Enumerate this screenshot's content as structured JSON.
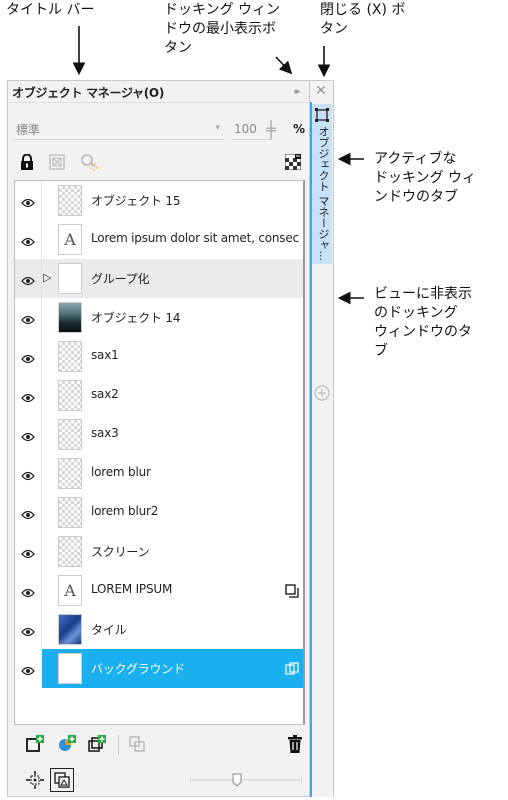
{
  "annotations": {
    "title_bar": "タイトル バー",
    "minimize": "ドッキング ウィン\nドウの最小表示ボ\nタン",
    "close": "閉じる (X) ボ\nタン",
    "active_tab": "アクティブな\nドッキング ウィ\nンドウのタブ",
    "hidden_tab": "ビューに非表示\nのドッキング\nウィンドウのタ\nブ"
  },
  "docker": {
    "title": "オブジェクト マネージャ(O)",
    "minimize_glyph": "▸▸",
    "close_glyph": "✕"
  },
  "blend": {
    "mode": "標準",
    "opacity": "100",
    "unit": "%"
  },
  "objects": [
    {
      "name": "オブジェクト 15",
      "thumb": "checker"
    },
    {
      "name": "Lorem ipsum dolor sit amet, consecte...",
      "thumb": "text",
      "glyph": "A"
    },
    {
      "name": "グループ化",
      "thumb": "white",
      "group": true,
      "expander": "▷"
    },
    {
      "name": "オブジェクト 14",
      "thumb": "photo"
    },
    {
      "name": "sax1",
      "thumb": "checker"
    },
    {
      "name": "sax2",
      "thumb": "checker"
    },
    {
      "name": "sax3",
      "thumb": "checker"
    },
    {
      "name": "lorem blur",
      "thumb": "checker"
    },
    {
      "name": "lorem blur2",
      "thumb": "checker"
    },
    {
      "name": "スクリーン",
      "thumb": "checker"
    },
    {
      "name": "LOREM IPSUM",
      "thumb": "text",
      "glyph": "A",
      "badge": "copy"
    },
    {
      "name": "タイル",
      "thumb": "tile"
    },
    {
      "name": "バックグラウンド",
      "thumb": "white",
      "selected": true,
      "badge": "link"
    }
  ],
  "tabs": {
    "active_label": "オブジェクト マネージャ...",
    "add_glyph": "+"
  },
  "colors": {
    "selection": "#1ab0ef",
    "active_tab": "#c7e2f8",
    "tab_edge": "#45a6df"
  }
}
